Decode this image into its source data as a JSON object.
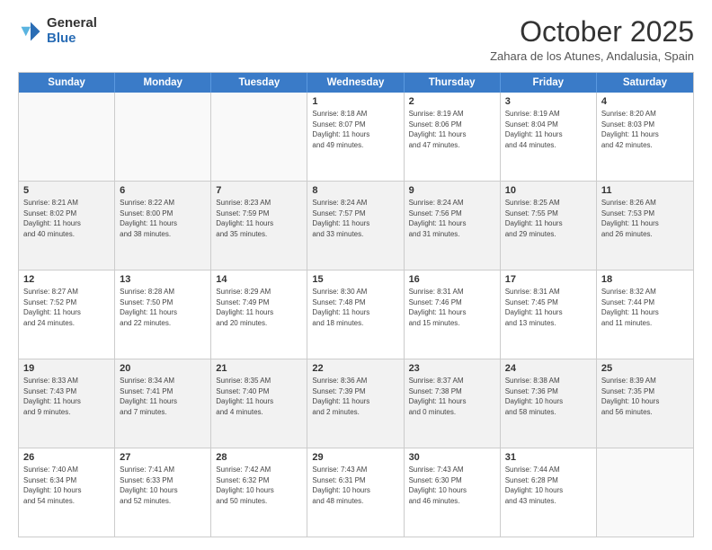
{
  "logo": {
    "general": "General",
    "blue": "Blue"
  },
  "header": {
    "month": "October 2025",
    "location": "Zahara de los Atunes, Andalusia, Spain"
  },
  "days": [
    "Sunday",
    "Monday",
    "Tuesday",
    "Wednesday",
    "Thursday",
    "Friday",
    "Saturday"
  ],
  "rows": [
    [
      {
        "day": "",
        "text": "",
        "empty": true
      },
      {
        "day": "",
        "text": "",
        "empty": true
      },
      {
        "day": "",
        "text": "",
        "empty": true
      },
      {
        "day": "1",
        "text": "Sunrise: 8:18 AM\nSunset: 8:07 PM\nDaylight: 11 hours\nand 49 minutes."
      },
      {
        "day": "2",
        "text": "Sunrise: 8:19 AM\nSunset: 8:06 PM\nDaylight: 11 hours\nand 47 minutes."
      },
      {
        "day": "3",
        "text": "Sunrise: 8:19 AM\nSunset: 8:04 PM\nDaylight: 11 hours\nand 44 minutes."
      },
      {
        "day": "4",
        "text": "Sunrise: 8:20 AM\nSunset: 8:03 PM\nDaylight: 11 hours\nand 42 minutes."
      }
    ],
    [
      {
        "day": "5",
        "text": "Sunrise: 8:21 AM\nSunset: 8:02 PM\nDaylight: 11 hours\nand 40 minutes.",
        "shaded": true
      },
      {
        "day": "6",
        "text": "Sunrise: 8:22 AM\nSunset: 8:00 PM\nDaylight: 11 hours\nand 38 minutes.",
        "shaded": true
      },
      {
        "day": "7",
        "text": "Sunrise: 8:23 AM\nSunset: 7:59 PM\nDaylight: 11 hours\nand 35 minutes.",
        "shaded": true
      },
      {
        "day": "8",
        "text": "Sunrise: 8:24 AM\nSunset: 7:57 PM\nDaylight: 11 hours\nand 33 minutes.",
        "shaded": true
      },
      {
        "day": "9",
        "text": "Sunrise: 8:24 AM\nSunset: 7:56 PM\nDaylight: 11 hours\nand 31 minutes.",
        "shaded": true
      },
      {
        "day": "10",
        "text": "Sunrise: 8:25 AM\nSunset: 7:55 PM\nDaylight: 11 hours\nand 29 minutes.",
        "shaded": true
      },
      {
        "day": "11",
        "text": "Sunrise: 8:26 AM\nSunset: 7:53 PM\nDaylight: 11 hours\nand 26 minutes.",
        "shaded": true
      }
    ],
    [
      {
        "day": "12",
        "text": "Sunrise: 8:27 AM\nSunset: 7:52 PM\nDaylight: 11 hours\nand 24 minutes."
      },
      {
        "day": "13",
        "text": "Sunrise: 8:28 AM\nSunset: 7:50 PM\nDaylight: 11 hours\nand 22 minutes."
      },
      {
        "day": "14",
        "text": "Sunrise: 8:29 AM\nSunset: 7:49 PM\nDaylight: 11 hours\nand 20 minutes."
      },
      {
        "day": "15",
        "text": "Sunrise: 8:30 AM\nSunset: 7:48 PM\nDaylight: 11 hours\nand 18 minutes."
      },
      {
        "day": "16",
        "text": "Sunrise: 8:31 AM\nSunset: 7:46 PM\nDaylight: 11 hours\nand 15 minutes."
      },
      {
        "day": "17",
        "text": "Sunrise: 8:31 AM\nSunset: 7:45 PM\nDaylight: 11 hours\nand 13 minutes."
      },
      {
        "day": "18",
        "text": "Sunrise: 8:32 AM\nSunset: 7:44 PM\nDaylight: 11 hours\nand 11 minutes."
      }
    ],
    [
      {
        "day": "19",
        "text": "Sunrise: 8:33 AM\nSunset: 7:43 PM\nDaylight: 11 hours\nand 9 minutes.",
        "shaded": true
      },
      {
        "day": "20",
        "text": "Sunrise: 8:34 AM\nSunset: 7:41 PM\nDaylight: 11 hours\nand 7 minutes.",
        "shaded": true
      },
      {
        "day": "21",
        "text": "Sunrise: 8:35 AM\nSunset: 7:40 PM\nDaylight: 11 hours\nand 4 minutes.",
        "shaded": true
      },
      {
        "day": "22",
        "text": "Sunrise: 8:36 AM\nSunset: 7:39 PM\nDaylight: 11 hours\nand 2 minutes.",
        "shaded": true
      },
      {
        "day": "23",
        "text": "Sunrise: 8:37 AM\nSunset: 7:38 PM\nDaylight: 11 hours\nand 0 minutes.",
        "shaded": true
      },
      {
        "day": "24",
        "text": "Sunrise: 8:38 AM\nSunset: 7:36 PM\nDaylight: 10 hours\nand 58 minutes.",
        "shaded": true
      },
      {
        "day": "25",
        "text": "Sunrise: 8:39 AM\nSunset: 7:35 PM\nDaylight: 10 hours\nand 56 minutes.",
        "shaded": true
      }
    ],
    [
      {
        "day": "26",
        "text": "Sunrise: 7:40 AM\nSunset: 6:34 PM\nDaylight: 10 hours\nand 54 minutes."
      },
      {
        "day": "27",
        "text": "Sunrise: 7:41 AM\nSunset: 6:33 PM\nDaylight: 10 hours\nand 52 minutes."
      },
      {
        "day": "28",
        "text": "Sunrise: 7:42 AM\nSunset: 6:32 PM\nDaylight: 10 hours\nand 50 minutes."
      },
      {
        "day": "29",
        "text": "Sunrise: 7:43 AM\nSunset: 6:31 PM\nDaylight: 10 hours\nand 48 minutes."
      },
      {
        "day": "30",
        "text": "Sunrise: 7:43 AM\nSunset: 6:30 PM\nDaylight: 10 hours\nand 46 minutes."
      },
      {
        "day": "31",
        "text": "Sunrise: 7:44 AM\nSunset: 6:28 PM\nDaylight: 10 hours\nand 43 minutes."
      },
      {
        "day": "",
        "text": "",
        "empty": true
      }
    ]
  ]
}
